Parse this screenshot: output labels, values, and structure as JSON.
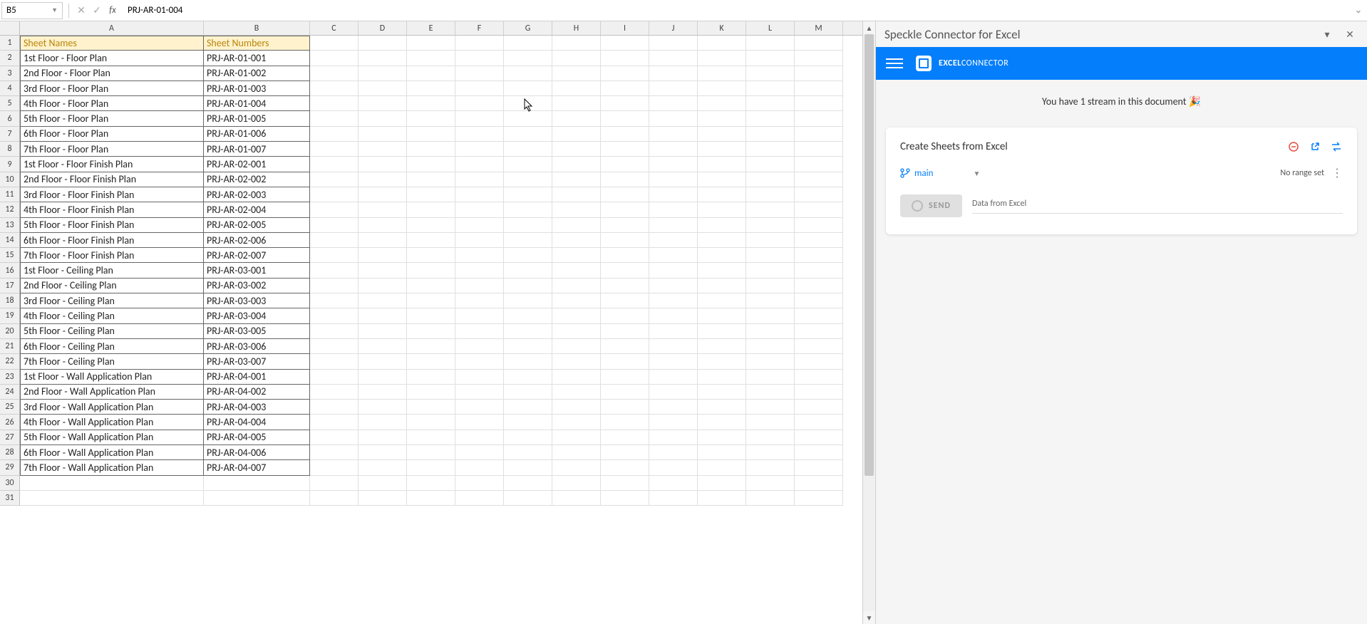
{
  "formulaBar": {
    "cellRef": "B5",
    "formula": "PRJ-AR-01-004"
  },
  "columns": [
    "A",
    "B",
    "C",
    "D",
    "E",
    "F",
    "G",
    "H",
    "I",
    "J",
    "K",
    "L",
    "M"
  ],
  "headers": {
    "colA": "Sheet Names",
    "colB": "Sheet Numbers"
  },
  "rows": [
    {
      "n": "1",
      "a": "Sheet Names",
      "b": "Sheet Numbers",
      "header": true
    },
    {
      "n": "2",
      "a": "1st Floor - Floor Plan",
      "b": "PRJ-AR-01-001"
    },
    {
      "n": "3",
      "a": "2nd Floor - Floor Plan",
      "b": "PRJ-AR-01-002"
    },
    {
      "n": "4",
      "a": "3rd Floor - Floor Plan",
      "b": "PRJ-AR-01-003"
    },
    {
      "n": "5",
      "a": "4th Floor - Floor Plan",
      "b": "PRJ-AR-01-004"
    },
    {
      "n": "6",
      "a": "5th Floor - Floor Plan",
      "b": "PRJ-AR-01-005"
    },
    {
      "n": "7",
      "a": "6th Floor - Floor Plan",
      "b": "PRJ-AR-01-006"
    },
    {
      "n": "8",
      "a": "7th Floor - Floor Plan",
      "b": "PRJ-AR-01-007"
    },
    {
      "n": "9",
      "a": "1st Floor - Floor Finish Plan",
      "b": "PRJ-AR-02-001"
    },
    {
      "n": "10",
      "a": "2nd Floor - Floor Finish Plan",
      "b": "PRJ-AR-02-002"
    },
    {
      "n": "11",
      "a": "3rd Floor - Floor Finish Plan",
      "b": "PRJ-AR-02-003"
    },
    {
      "n": "12",
      "a": "4th Floor - Floor Finish Plan",
      "b": "PRJ-AR-02-004"
    },
    {
      "n": "13",
      "a": "5th Floor - Floor Finish Plan",
      "b": "PRJ-AR-02-005"
    },
    {
      "n": "14",
      "a": "6th Floor - Floor Finish Plan",
      "b": "PRJ-AR-02-006"
    },
    {
      "n": "15",
      "a": "7th Floor - Floor Finish Plan",
      "b": "PRJ-AR-02-007"
    },
    {
      "n": "16",
      "a": "1st Floor - Ceiling Plan",
      "b": "PRJ-AR-03-001"
    },
    {
      "n": "17",
      "a": "2nd Floor - Ceiling Plan",
      "b": "PRJ-AR-03-002"
    },
    {
      "n": "18",
      "a": "3rd Floor - Ceiling Plan",
      "b": "PRJ-AR-03-003"
    },
    {
      "n": "19",
      "a": "4th Floor - Ceiling Plan",
      "b": "PRJ-AR-03-004"
    },
    {
      "n": "20",
      "a": "5th Floor - Ceiling Plan",
      "b": "PRJ-AR-03-005"
    },
    {
      "n": "21",
      "a": "6th Floor - Ceiling Plan",
      "b": "PRJ-AR-03-006"
    },
    {
      "n": "22",
      "a": "7th Floor - Ceiling Plan",
      "b": "PRJ-AR-03-007"
    },
    {
      "n": "23",
      "a": "1st Floor - Wall Application Plan",
      "b": "PRJ-AR-04-001"
    },
    {
      "n": "24",
      "a": "2nd Floor - Wall Application Plan",
      "b": "PRJ-AR-04-002"
    },
    {
      "n": "25",
      "a": "3rd Floor - Wall Application Plan",
      "b": "PRJ-AR-04-003"
    },
    {
      "n": "26",
      "a": "4th Floor - Wall Application Plan",
      "b": "PRJ-AR-04-004"
    },
    {
      "n": "27",
      "a": "5th Floor - Wall Application Plan",
      "b": "PRJ-AR-04-005"
    },
    {
      "n": "28",
      "a": "6th Floor - Wall Application Plan",
      "b": "PRJ-AR-04-006"
    },
    {
      "n": "29",
      "a": "7th Floor - Wall Application Plan",
      "b": "PRJ-AR-04-007"
    },
    {
      "n": "30",
      "a": "",
      "b": "",
      "empty": true
    },
    {
      "n": "31",
      "a": "",
      "b": "",
      "empty": true
    }
  ],
  "panel": {
    "title": "Speckle Connector for Excel",
    "appName1": "EXCEL",
    "appName2": "CONNECTOR",
    "streamMsg": "You have 1 stream in this document 🎉",
    "cardTitle": "Create Sheets from Excel",
    "branch": "main",
    "rangeText": "No range set",
    "sendLabel": "SEND",
    "dataLabel": "Data from Excel"
  }
}
